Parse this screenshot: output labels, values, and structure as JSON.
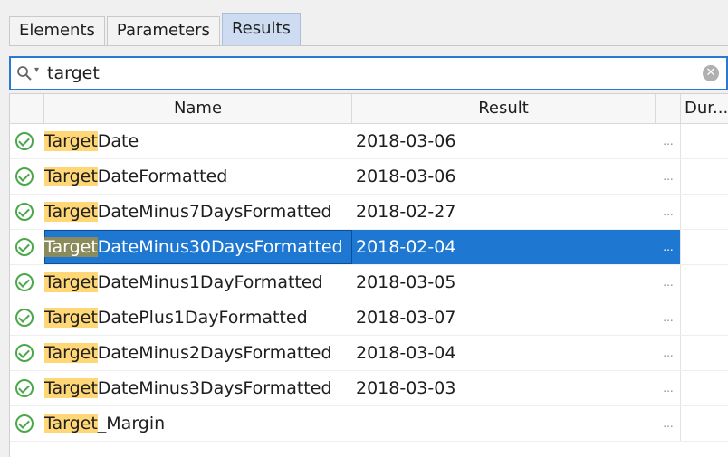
{
  "tabs": [
    {
      "label": "Elements"
    },
    {
      "label": "Parameters"
    },
    {
      "label": "Results"
    }
  ],
  "active_tab": "Results",
  "search": {
    "value": "target",
    "icon": "search-icon"
  },
  "columns": {
    "name": "Name",
    "result": "Result",
    "duration": "Dur..."
  },
  "highlight_color": "#ffd776",
  "selection_color": "#1e78d2",
  "rows": [
    {
      "prefix": "Target",
      "rest": "Date",
      "result": "2018-03-06",
      "more": "...",
      "status": "success"
    },
    {
      "prefix": "Target",
      "rest": "DateFormatted",
      "result": "2018-03-06",
      "more": "...",
      "status": "success"
    },
    {
      "prefix": "Target",
      "rest": "DateMinus7DaysFormatted",
      "result": "2018-02-27",
      "more": "...",
      "status": "success"
    },
    {
      "prefix": "Target",
      "rest": "DateMinus30DaysFormatted",
      "result": "2018-02-04",
      "more": "...",
      "status": "success",
      "selected": true
    },
    {
      "prefix": "Target",
      "rest": "DateMinus1DayFormatted",
      "result": "2018-03-05",
      "more": "...",
      "status": "success"
    },
    {
      "prefix": "Target",
      "rest": "DatePlus1DayFormatted",
      "result": "2018-03-07",
      "more": "...",
      "status": "success"
    },
    {
      "prefix": "Target",
      "rest": "DateMinus2DaysFormatted",
      "result": "2018-03-04",
      "more": "...",
      "status": "success"
    },
    {
      "prefix": "Target",
      "rest": "DateMinus3DaysFormatted",
      "result": "2018-03-03",
      "more": "...",
      "status": "success"
    },
    {
      "prefix": "Target",
      "rest": "_Margin",
      "result": "",
      "more": "...",
      "status": "success"
    }
  ]
}
